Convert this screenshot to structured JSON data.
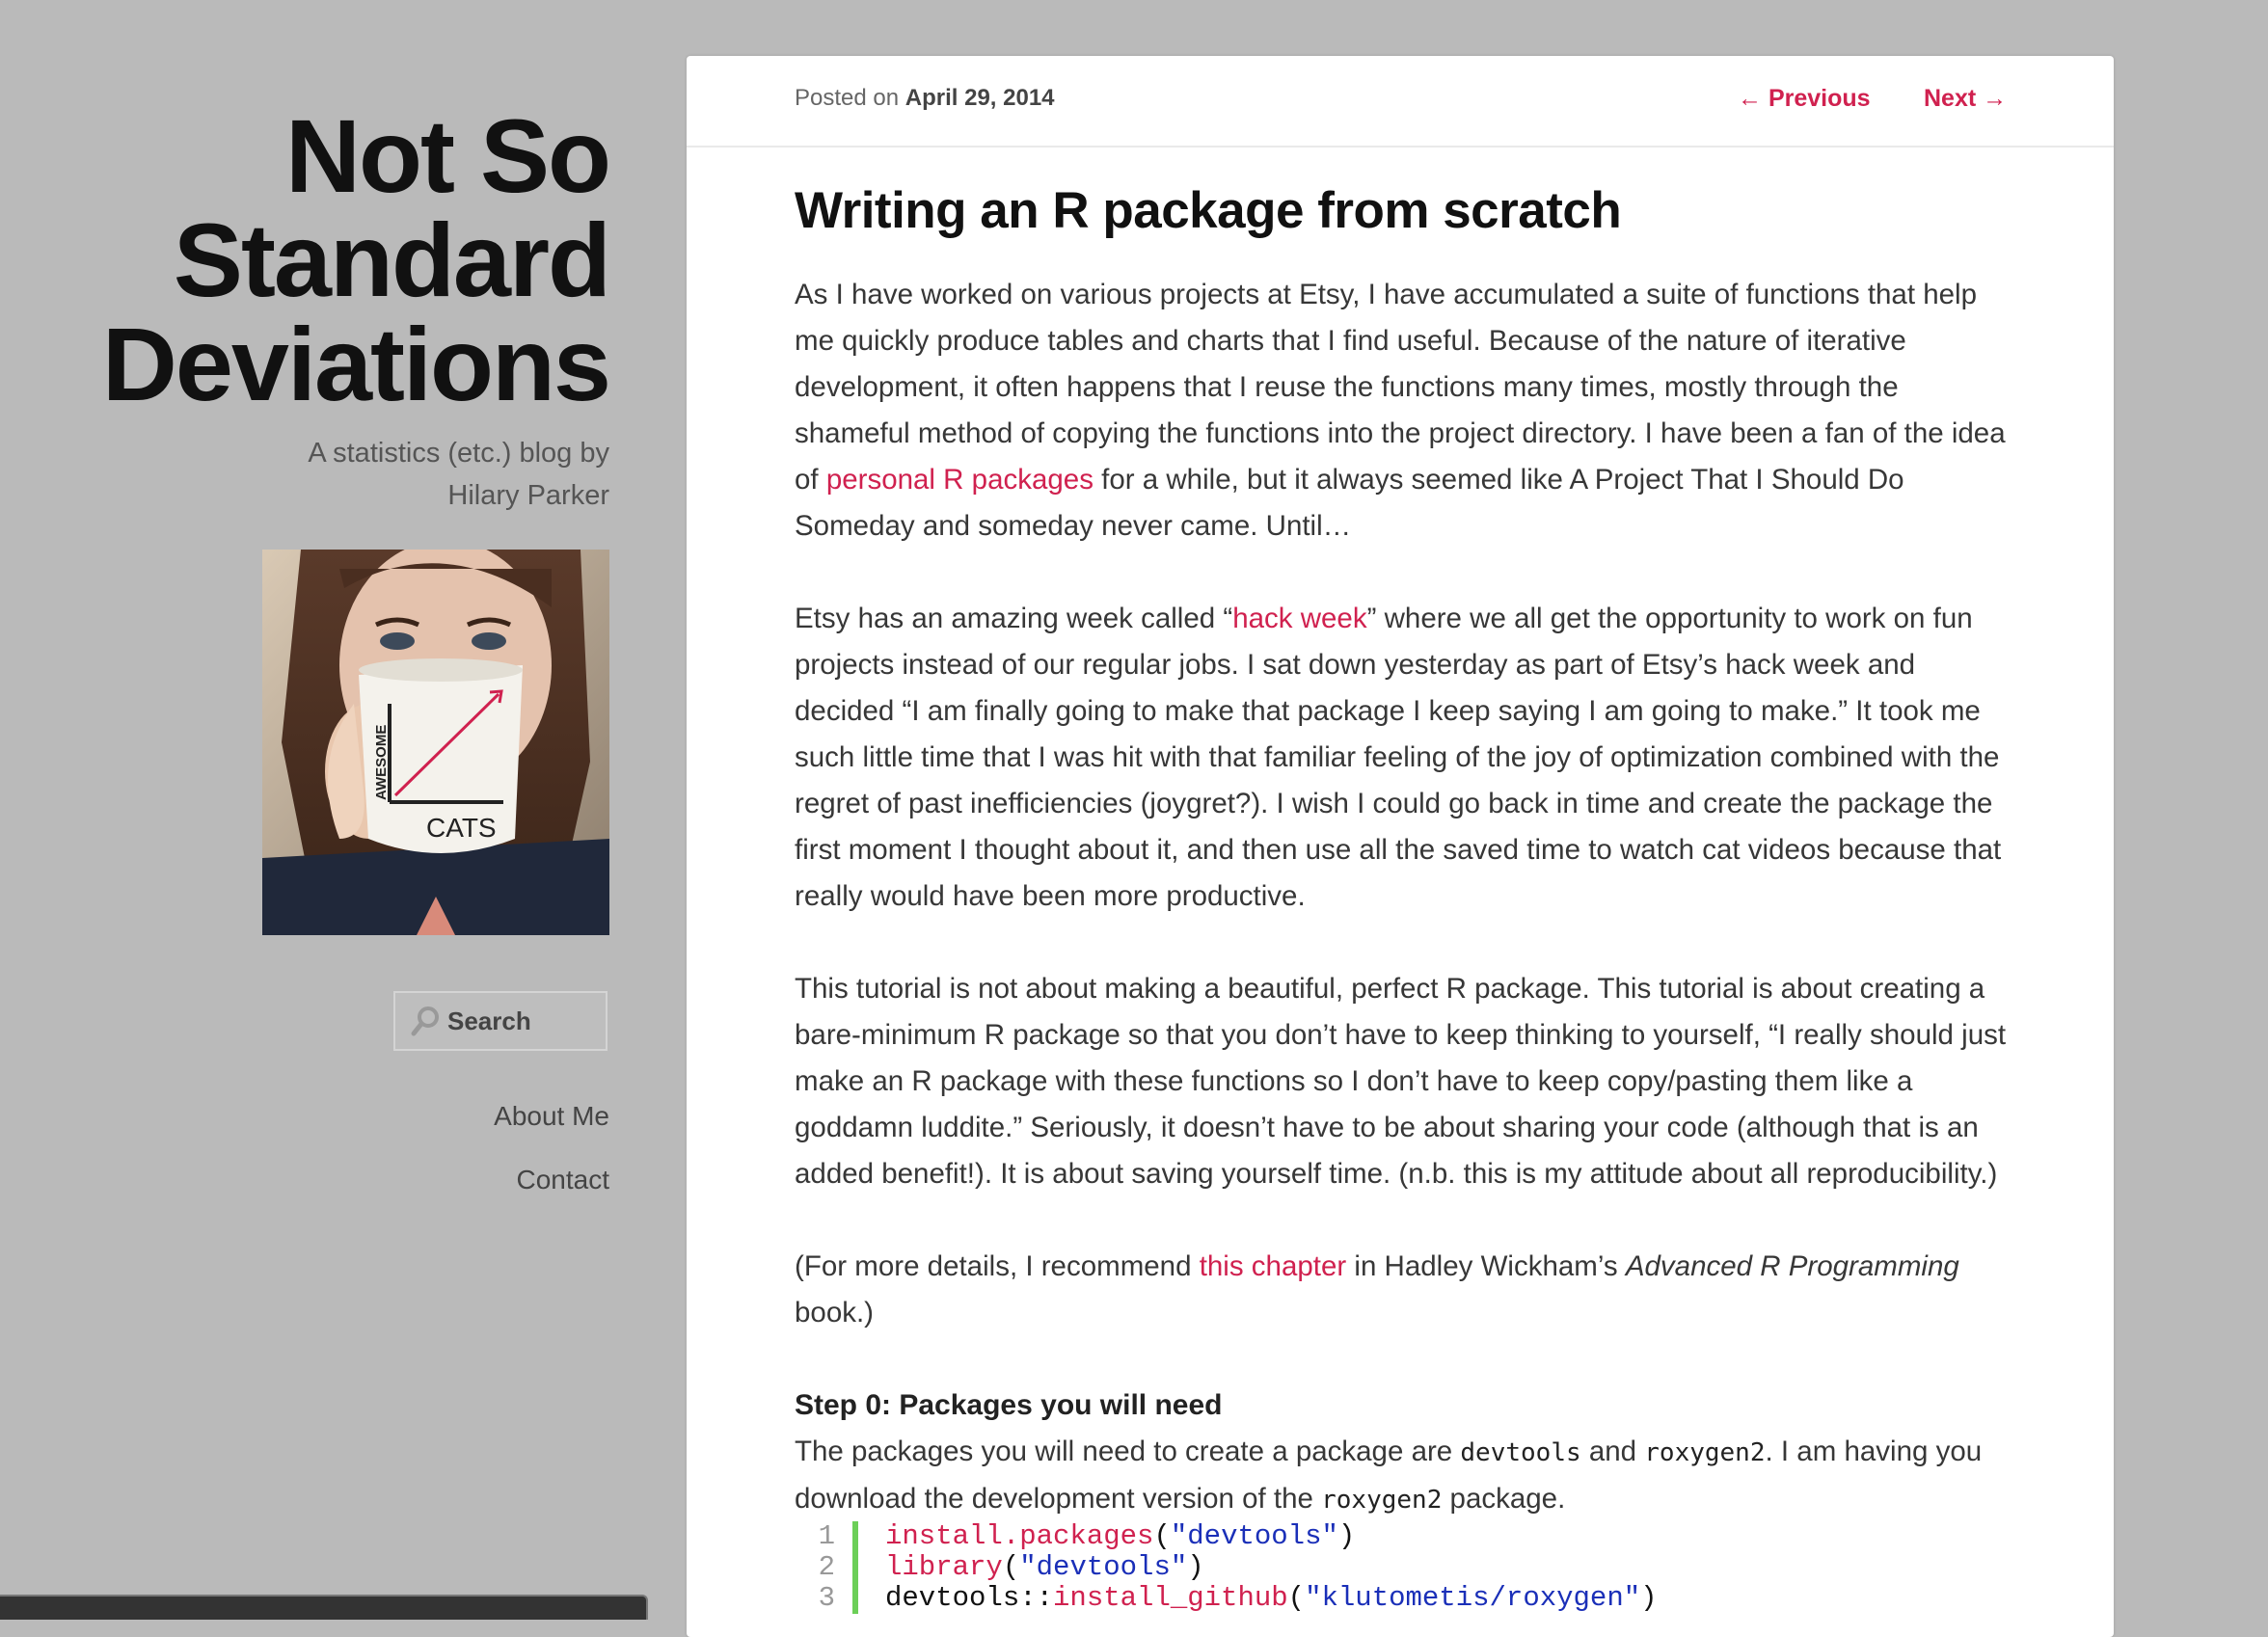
{
  "site": {
    "title_lines": [
      "Not So",
      "Standard",
      "Deviations"
    ],
    "description": "A statistics (etc.) blog by Hilary Parker",
    "avatar_mug_label": "CATS",
    "avatar_mug_axis": "AWESOME"
  },
  "search": {
    "placeholder": "Search"
  },
  "sidebar_nav": [
    {
      "label": "About Me"
    },
    {
      "label": "Contact"
    }
  ],
  "post": {
    "posted_prefix": "Posted on",
    "date": "April 29, 2014",
    "prev_label": "← Previous",
    "next_label": "Next →",
    "title": "Writing an R package from scratch",
    "p1_a": "As I have worked on various projects at Etsy, I have accumulated a suite of functions that help me quickly produce tables and charts that I find useful. Because of the nature of iterative development, it often happens that I reuse the functions many times, mostly through the shameful method of copying the functions into the project directory. I have been a fan of the idea of ",
    "p1_link": "personal R packages",
    "p1_b": " for a while, but it always seemed like A Project That I Should Do Someday and someday never came. Until…",
    "p2_a": "Etsy has an amazing week called “",
    "p2_link": "hack week",
    "p2_b": "” where we all get the opportunity to work on fun projects instead of our regular jobs. I sat down yesterday as part of Etsy’s hack week and decided “I am finally going to make that package I keep saying I am going to make.” It took me such little time that I was hit with that familiar feeling of the joy of optimization combined with the regret of past inefficiencies (joygret?). I wish I could go back in time and create the package the first moment I thought about it, and then use all the saved time to watch cat videos because that really would have been more productive.",
    "p3": "This tutorial is not about making a beautiful, perfect R package. This tutorial is about creating a bare-minimum R package so that you don’t have to keep thinking to yourself, “I really should just make an R package with these functions so I don’t have to keep copy/pasting them like a goddamn luddite.” Seriously, it doesn’t have to be about sharing your code (although that is an added benefit!). It is about saving yourself time. (n.b. this is my attitude about all reproducibility.)",
    "p4_a": "(For more details, I recommend ",
    "p4_link": "this chapter",
    "p4_b": " in Hadley Wickham’s ",
    "p4_em": "Advanced R Programming",
    "p4_c": " book.)",
    "step0_heading": "Step 0: Packages you will need",
    "step0_a": "The packages you will need to create a package are ",
    "step0_code1": "devtools",
    "step0_b": " and ",
    "step0_code2": "roxygen2",
    "step0_c": ". I am having you download the development version of the ",
    "step0_code3": "roxygen2",
    "step0_d": " package."
  },
  "code": {
    "lines": [
      {
        "num": "1",
        "prefix": "",
        "fn": "install.packages",
        "open": "(",
        "str": "\"devtools\"",
        "close": ")"
      },
      {
        "num": "2",
        "prefix": "",
        "fn": "library",
        "open": "(",
        "str": "\"devtools\"",
        "close": ")"
      },
      {
        "num": "3",
        "prefix": "devtools::",
        "fn": "install_github",
        "open": "(",
        "str": "\"klutometis/roxygen\"",
        "close": ")"
      }
    ]
  },
  "colors": {
    "accent": "#d0214f",
    "code_bar": "#6ccf58",
    "string": "#1a2fb8",
    "background": "#bababa"
  }
}
